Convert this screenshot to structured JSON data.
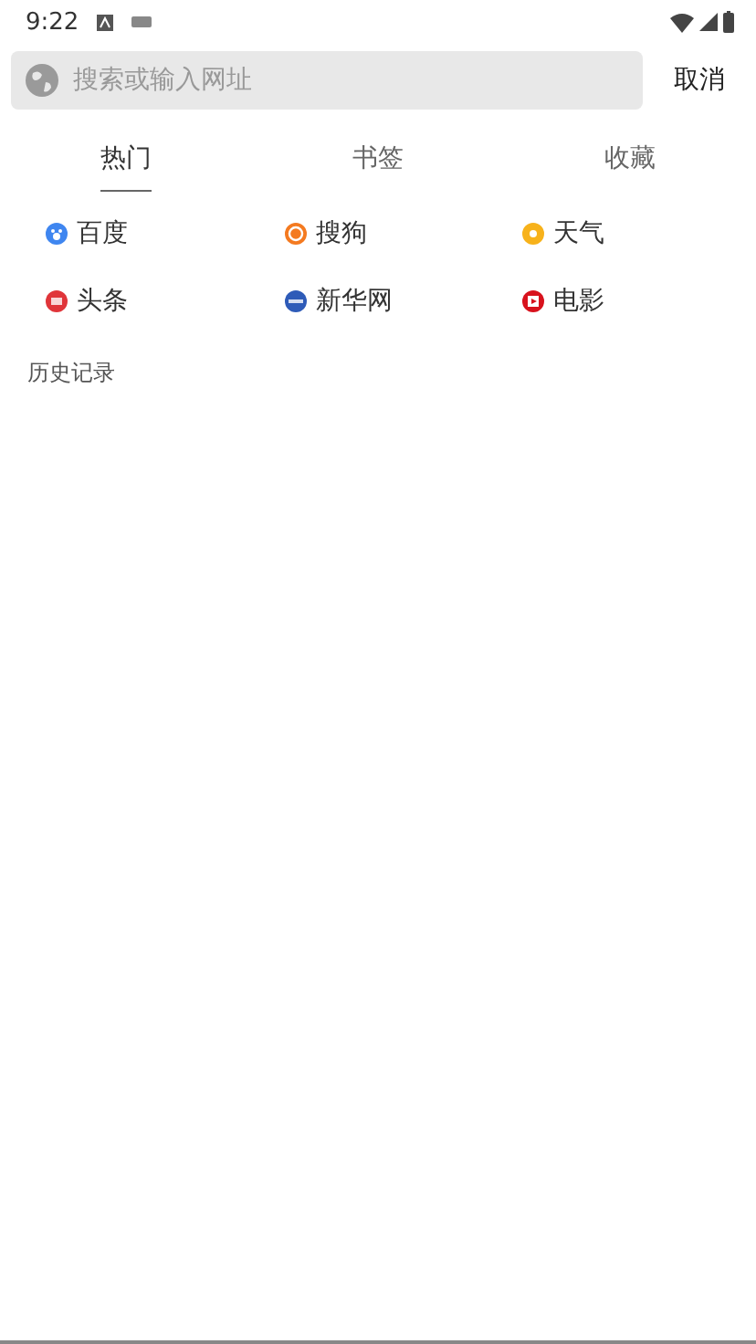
{
  "status_bar": {
    "time": "9:22"
  },
  "search": {
    "placeholder": "搜索或输入网址",
    "cancel": "取消"
  },
  "tabs": [
    {
      "label": "热门",
      "selected": true
    },
    {
      "label": "书签",
      "selected": false
    },
    {
      "label": "收藏",
      "selected": false
    }
  ],
  "sites": [
    {
      "label": "百度",
      "color": "#3f86f0",
      "kind": "paw"
    },
    {
      "label": "搜狗",
      "color": "#f47a20",
      "kind": "letter"
    },
    {
      "label": "天气",
      "color": "#f7b21b",
      "kind": "sun"
    },
    {
      "label": "头条",
      "color": "#e0353a",
      "kind": "news"
    },
    {
      "label": "新华网",
      "color": "#2e5bb8",
      "kind": "globe"
    },
    {
      "label": "电影",
      "color": "#d8121d",
      "kind": "play"
    }
  ],
  "history": {
    "title": "历史记录"
  }
}
